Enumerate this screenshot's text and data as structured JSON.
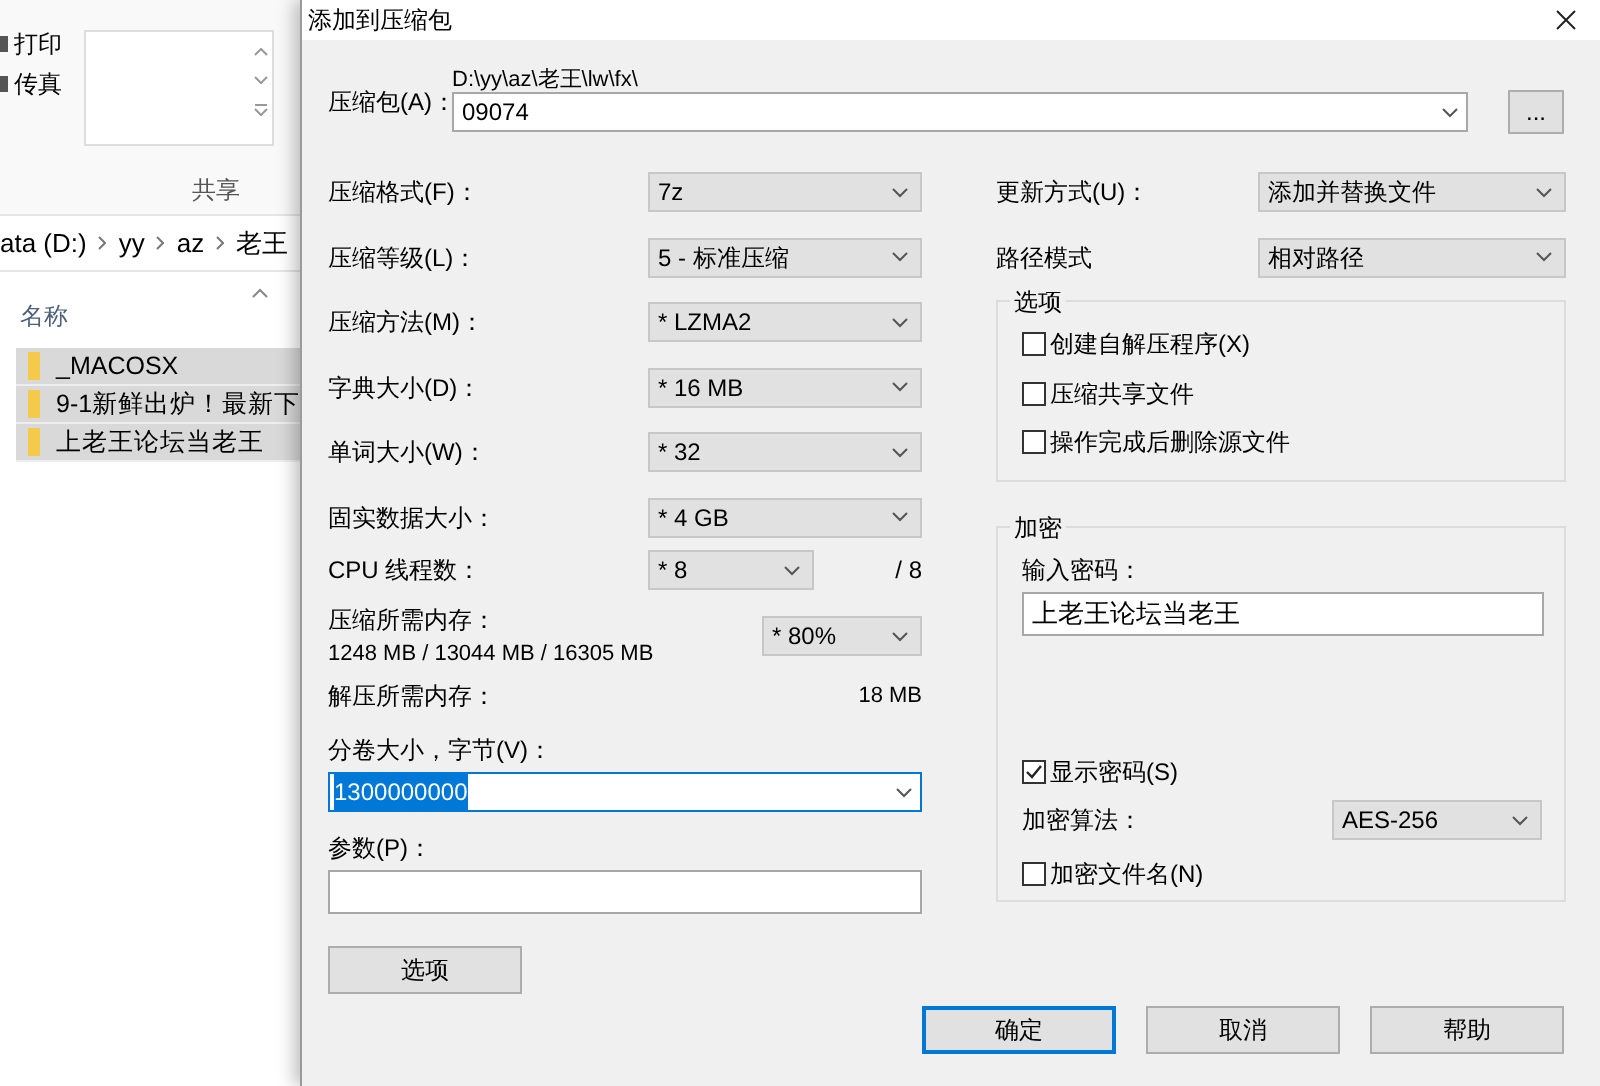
{
  "explorer": {
    "ribbon_items": [
      {
        "label": "打印"
      },
      {
        "label": "传真"
      }
    ],
    "ribbon_group": "共享",
    "breadcrumb": [
      "ata (D:)",
      "yy",
      "az",
      "老王"
    ],
    "column_header": "名称",
    "files": [
      {
        "name": "_MACOSX",
        "selected": true
      },
      {
        "name": "9-1新鲜出炉！最新下",
        "selected": true
      },
      {
        "name": "上老王论坛当老王",
        "selected": true
      }
    ]
  },
  "dialog": {
    "title": "添加到压缩包",
    "archive": {
      "label": "压缩包(A)：",
      "path": "D:\\yy\\az\\老王\\lw\\fx\\",
      "value": "09074",
      "browse": "..."
    },
    "settings": [
      {
        "kind": "select",
        "label": "压缩格式(F)：",
        "value": "7z"
      },
      {
        "kind": "select",
        "label": "压缩等级(L)：",
        "value": "5 - 标准压缩"
      },
      {
        "kind": "select",
        "label": "压缩方法(M)：",
        "value": "* LZMA2"
      },
      {
        "kind": "select",
        "label": "字典大小(D)：",
        "value": "* 16 MB"
      },
      {
        "kind": "select",
        "label": "单词大小(W)：",
        "value": "* 32"
      },
      {
        "kind": "select",
        "label": "固实数据大小：",
        "value": "* 4 GB"
      },
      {
        "kind": "threads",
        "label": "CPU 线程数：",
        "value": "* 8",
        "suffix": "/ 8"
      },
      {
        "kind": "memory",
        "label": "压缩所需内存：",
        "detail": "1248 MB / 13044 MB / 16305 MB",
        "value": "* 80%"
      },
      {
        "kind": "info",
        "label": "解压所需内存：",
        "value": "18 MB"
      }
    ],
    "volume": {
      "label": "分卷大小，字节(V)：",
      "value": "1300000000"
    },
    "params": {
      "label": "参数(P)："
    },
    "options_button": "选项",
    "update": {
      "label": "更新方式(U)：",
      "value": "添加并替换文件"
    },
    "path_mode": {
      "label": "路径模式",
      "value": "相对路径"
    },
    "options": {
      "title": "选项",
      "checkboxes": [
        {
          "label": "创建自解压程序(X)",
          "checked": false
        },
        {
          "label": "压缩共享文件",
          "checked": false
        },
        {
          "label": "操作完成后删除源文件",
          "checked": false
        }
      ]
    },
    "encryption": {
      "title": "加密",
      "password_label": "输入密码：",
      "password": "上老王论坛当老王",
      "show_password": {
        "label": "显示密码(S)",
        "checked": true
      },
      "method_label": "加密算法：",
      "method": "AES-256",
      "encrypt_names": {
        "label": "加密文件名(N)",
        "checked": false
      }
    },
    "buttons": [
      {
        "label": "确定",
        "default": true
      },
      {
        "label": "取消",
        "default": false
      },
      {
        "label": "帮助",
        "default": false
      }
    ]
  }
}
